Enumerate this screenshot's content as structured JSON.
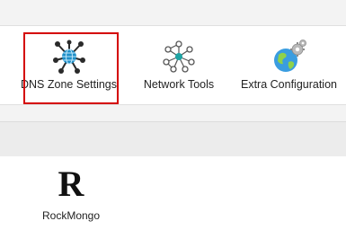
{
  "tools": {
    "dns_zone_settings": {
      "label": "DNS Zone Settings",
      "icon": "dns-network-icon"
    },
    "network_tools": {
      "label": "Network Tools",
      "icon": "network-nodes-icon"
    },
    "extra_configuration": {
      "label": "Extra Configuration",
      "icon": "globe-gears-icon"
    }
  },
  "apps": {
    "rockmongo": {
      "logo_text": "R",
      "label": "RockMongo"
    }
  },
  "colors": {
    "highlight": "#d40000",
    "accent": "#1e8fc8"
  }
}
